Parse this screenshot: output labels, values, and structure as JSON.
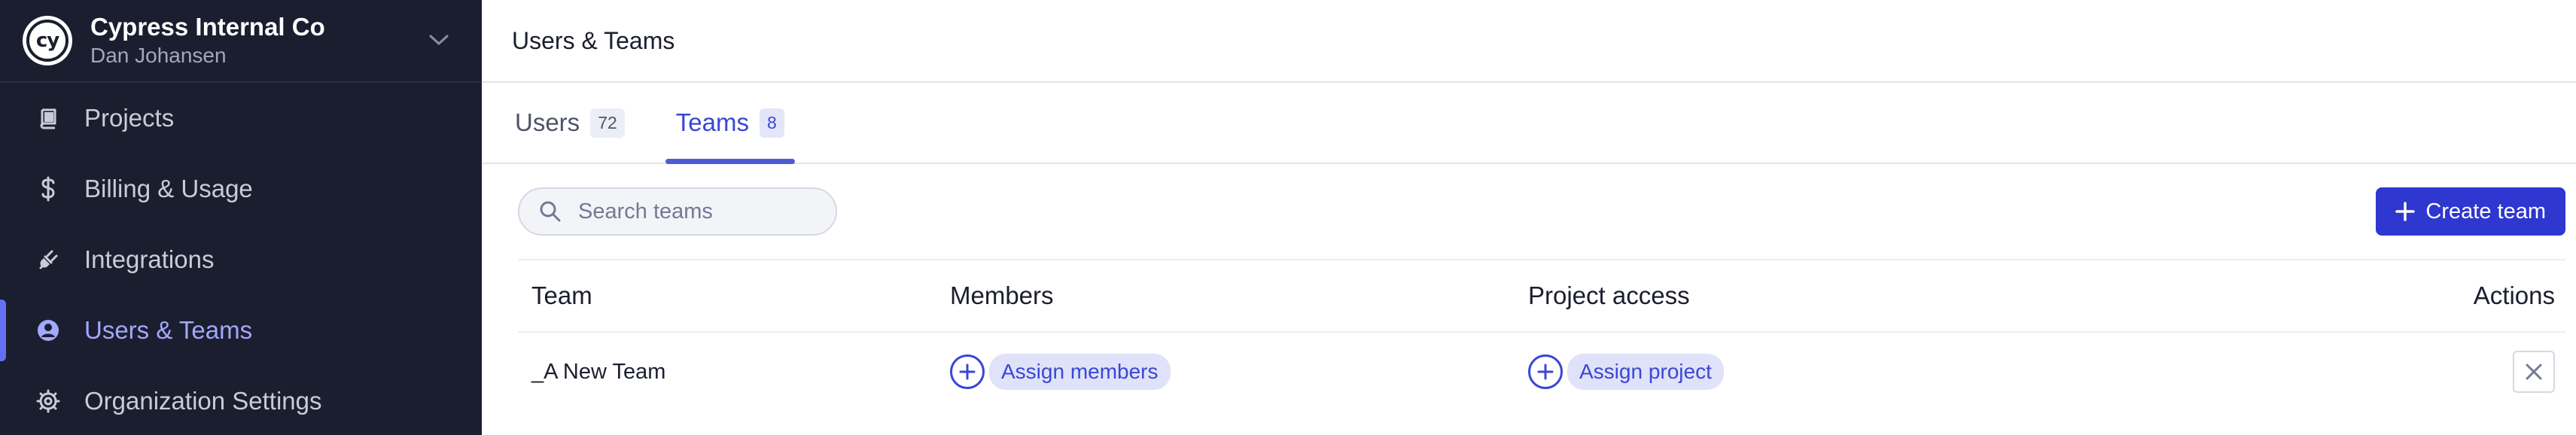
{
  "org": {
    "logo_text": "cy",
    "name": "Cypress Internal Co",
    "user": "Dan Johansen"
  },
  "sidebar": {
    "items": [
      {
        "label": "Projects",
        "icon": "book-icon",
        "active": false
      },
      {
        "label": "Billing & Usage",
        "icon": "dollar-icon",
        "active": false
      },
      {
        "label": "Integrations",
        "icon": "plug-icon",
        "active": false
      },
      {
        "label": "Users & Teams",
        "icon": "user-circle-icon",
        "active": true
      },
      {
        "label": "Organization Settings",
        "icon": "gear-icon",
        "active": false
      }
    ]
  },
  "header": {
    "title": "Users & Teams"
  },
  "tabs": [
    {
      "label": "Users",
      "count": "72",
      "active": false
    },
    {
      "label": "Teams",
      "count": "8",
      "active": true
    }
  ],
  "search": {
    "placeholder": "Search teams",
    "value": ""
  },
  "toolbar": {
    "create_label": "Create team"
  },
  "table": {
    "columns": [
      "Team",
      "Members",
      "Project access",
      "Actions"
    ],
    "rows": [
      {
        "team": "_A New Team",
        "members_action": "Assign members",
        "access_action": "Assign project"
      }
    ]
  },
  "colors": {
    "sidebar_bg": "#1b1e2e",
    "accent": "#3a46d6",
    "primary_button": "#2e37cf",
    "active_indicator": "#6470f3"
  }
}
